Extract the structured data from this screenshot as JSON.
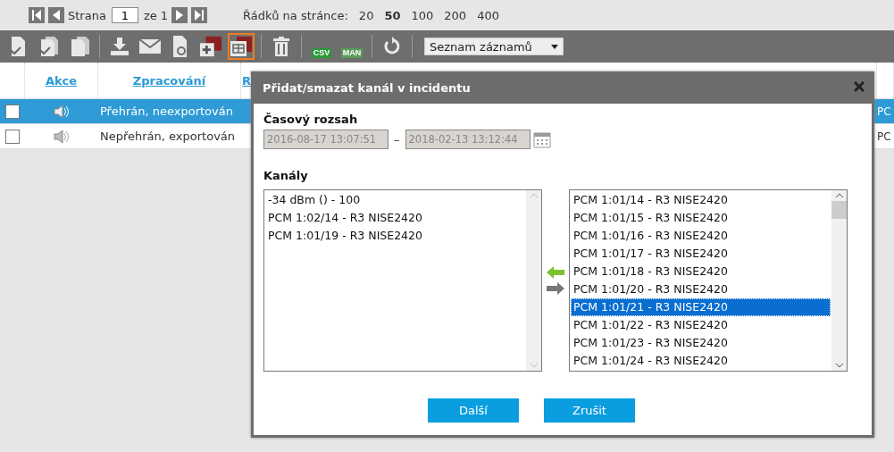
{
  "pager": {
    "page_label": "Strana",
    "page": "1",
    "of_label": "ze 1",
    "rows_label": "Řádků na stránce:",
    "sizes": [
      {
        "label": "20",
        "selected": false
      },
      {
        "label": "50",
        "selected": true
      },
      {
        "label": "100",
        "selected": false
      },
      {
        "label": "200",
        "selected": false
      },
      {
        "label": "400",
        "selected": false
      }
    ]
  },
  "toolbar": {
    "buttons": [
      {
        "kind": "doc-check",
        "selected": false
      },
      {
        "kind": "docs-check",
        "selected": false
      },
      {
        "kind": "docs",
        "selected": false
      },
      {
        "kind": "sep"
      },
      {
        "kind": "download",
        "selected": false
      },
      {
        "kind": "mail",
        "selected": false
      },
      {
        "kind": "doc-gear",
        "selected": false
      },
      {
        "kind": "add-panel",
        "selected": false
      },
      {
        "kind": "edit-panel",
        "selected": true
      },
      {
        "kind": "sep"
      },
      {
        "kind": "trash",
        "selected": false
      },
      {
        "kind": "sep"
      },
      {
        "kind": "csv",
        "text": "CSV",
        "selected": false
      },
      {
        "kind": "man",
        "text": "MAN",
        "selected": false
      },
      {
        "kind": "sep"
      },
      {
        "kind": "refresh",
        "selected": false
      }
    ],
    "view_select": "Seznam záznamů"
  },
  "table": {
    "columns": [
      "Akce",
      "Zpracování",
      "R"
    ],
    "rows": [
      {
        "checked": false,
        "selected": true,
        "processing": "Přehrán, neexportován",
        "column_4": "PC"
      },
      {
        "checked": false,
        "selected": false,
        "processing": "Nepřehrán, exportován",
        "column_4": "PC"
      }
    ]
  },
  "dialog": {
    "title": "Přidat/smazat kanál v incidentu",
    "range_label": "Časový rozsah",
    "from": "2016-08-17 13:07:51",
    "dash": "–",
    "to": "2018-02-13 13:12:44",
    "channels_label": "Kanály",
    "left_items": [
      {
        "label": "-34 dBm () - 100",
        "selected": false
      },
      {
        "label": "PCM 1:02/14 - R3 NISE2420",
        "selected": false
      },
      {
        "label": "PCM 1:01/19 - R3 NISE2420",
        "selected": false
      }
    ],
    "right_items": [
      {
        "label": "PCM 1:01/14 - R3 NISE2420",
        "selected": false
      },
      {
        "label": "PCM 1:01/15 - R3 NISE2420",
        "selected": false
      },
      {
        "label": "PCM 1:01/16 - R3 NISE2420",
        "selected": false
      },
      {
        "label": "PCM 1:01/17 - R3 NISE2420",
        "selected": false
      },
      {
        "label": "PCM 1:01/18 - R3 NISE2420",
        "selected": false
      },
      {
        "label": "PCM 1:01/20 - R3 NISE2420",
        "selected": false
      },
      {
        "label": "PCM 1:01/21 - R3 NISE2420",
        "selected": true
      },
      {
        "label": "PCM 1:01/22 - R3 NISE2420",
        "selected": false
      },
      {
        "label": "PCM 1:01/23 - R3 NISE2420",
        "selected": false
      },
      {
        "label": "PCM 1:01/24 - R3 NISE2420",
        "selected": false
      }
    ],
    "buttons": [
      "Další",
      "Zrušit"
    ]
  }
}
